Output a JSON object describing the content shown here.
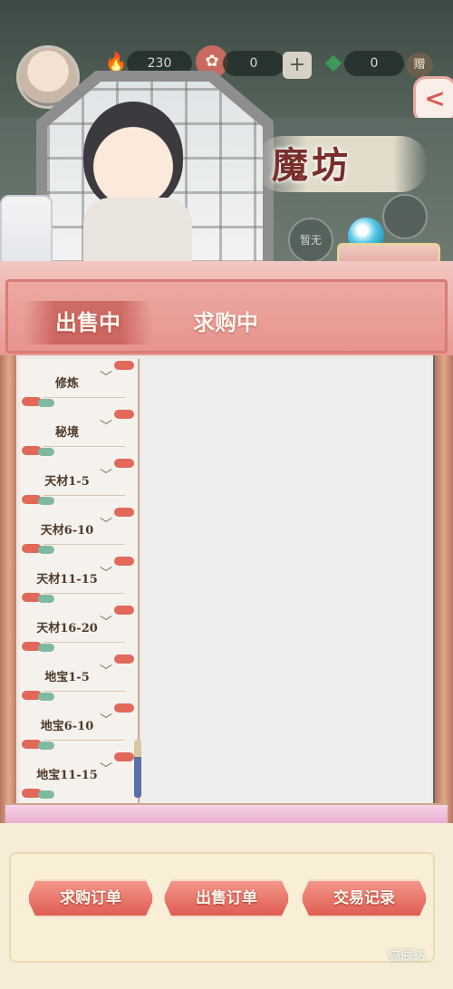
{
  "resources": {
    "stamina_value": "230",
    "token_value": "0",
    "jade_value": "0",
    "plus_label": "+",
    "gift_label": "赠"
  },
  "back_label": "<",
  "title": "魔坊",
  "side_button_label": "暂无",
  "tabs": [
    {
      "label": "出售中",
      "active": true
    },
    {
      "label": "求购中",
      "active": false
    }
  ],
  "categories": [
    {
      "label": "修炼"
    },
    {
      "label": "秘境"
    },
    {
      "label": "天材1-5"
    },
    {
      "label": "天材6-10"
    },
    {
      "label": "天材11-15"
    },
    {
      "label": "天材16-20"
    },
    {
      "label": "地宝1-5"
    },
    {
      "label": "地宝6-10"
    },
    {
      "label": "地宝11-15"
    }
  ],
  "chevron_glyph": "﹀",
  "actions": {
    "buy_orders": "求购订单",
    "sell_orders": "出售订单",
    "trade_records": "交易记录"
  },
  "watermark": "猫辰达",
  "colors": {
    "accent": "#df5d52",
    "panel_pink": "#e99791",
    "text_dark": "#4f3a2a"
  },
  "icons": [
    "fire-icon",
    "coin-icon",
    "jade-icon",
    "back-arrow-icon",
    "chevron-down-icon"
  ]
}
